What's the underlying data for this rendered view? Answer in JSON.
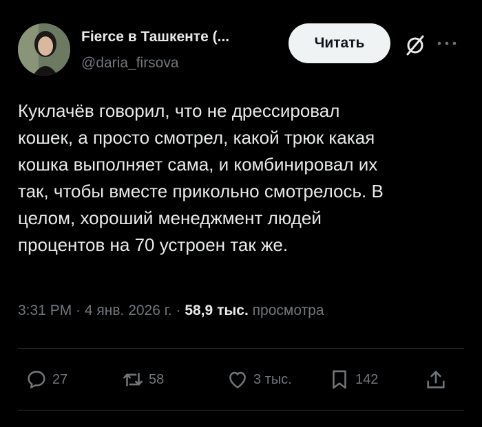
{
  "author": {
    "display_name": "Fierce в Ташкенте (...",
    "handle": "@daria_firsova"
  },
  "follow_label": "Читать",
  "tweet": {
    "lines": [
      "Куклачёв говорил, что не дрессировал",
      "кошек, а просто смотрел, какой трюк какая",
      "кошка выполняет сама, и комбинировал их",
      "так, чтобы вместе прикольно смотрелось. В",
      "целом, хороший менеджмент людей",
      "процентов на 70 устроен так же."
    ]
  },
  "meta": {
    "time": "3:31 PM",
    "sep1": " · ",
    "date": "4 янв. 2026 г.",
    "sep2": " · ",
    "views_count": "58,9 тыс.",
    "views_label": " просмотра"
  },
  "actions": {
    "replies": "27",
    "reposts": "58",
    "likes": "3 тыс.",
    "bookmarks": "142"
  },
  "icons": [
    "avatar",
    "grok-icon",
    "more-icon",
    "reply-icon",
    "repost-icon",
    "like-icon",
    "bookmark-icon",
    "share-icon"
  ],
  "colors": {
    "background": "#000000",
    "text": "#e7e9ea",
    "secondary": "#71767b",
    "button_bg": "#eff3f4"
  }
}
